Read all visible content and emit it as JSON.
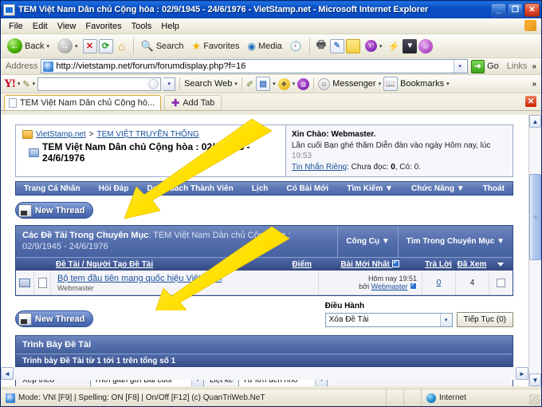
{
  "window": {
    "title": "TEM Việt Nam Dân chủ Cộng hòa : 02/9/1945 - 24/6/1976 - VietStamp.net - Microsoft Internet Explorer",
    "minimize": "_",
    "maximize": "❐",
    "close": "✕"
  },
  "menu": {
    "items": [
      "File",
      "Edit",
      "View",
      "Favorites",
      "Tools",
      "Help"
    ]
  },
  "toolbar": {
    "back_label": "Back",
    "back_caret": "▾",
    "forward_caret": "▾",
    "stop_glyph": "✕",
    "refresh_glyph": "⟳",
    "home_glyph": "⌂",
    "search_label": "Search",
    "search_glyph": "🔍",
    "favorites_label": "Favorites",
    "favorites_glyph": "★",
    "media_label": "Media",
    "media_glyph": "◉",
    "history_glyph": "🕘",
    "print_glyph": "🖶",
    "edit_glyph": "✎",
    "note_glyph": "",
    "yahoo_glyph": "Y!",
    "yahoo_caret": "▾",
    "lightning_glyph": "⚡",
    "dark_glyph": "▼",
    "smiley_glyph": "☺"
  },
  "address": {
    "label": "Address",
    "value": "http://vietstamp.net/forum/forumdisplay.php?f=16",
    "caret": "▾",
    "go_label": "Go",
    "go_glyph": "➜",
    "links_label": "Links",
    "chevron": "»"
  },
  "yahoo_toolbar": {
    "logo": "Y!",
    "logo_caret": "▾",
    "pencil_caret": "▾",
    "search_value": "",
    "search_caret": "▾",
    "search_web_label": "Search Web",
    "search_web_caret": "▾",
    "highlight_glyph": "✐",
    "tabs_glyph": "▤",
    "tabs_caret": "▾",
    "anti_spy_glyph": "✥",
    "anti_spy_caret": "▾",
    "popup_glyph": "◍",
    "messenger_label": "Messenger",
    "messenger_caret": "▾",
    "bookmarks_label": "Bookmarks",
    "bookmarks_caret": "▾",
    "overflow": "»"
  },
  "tabbar": {
    "tabs": [
      {
        "label": "TEM Việt Nam Dân chủ Cộng hò..."
      }
    ],
    "add_tab_label": "Add Tab",
    "add_tab_glyph": "✚",
    "close_glyph": "✕"
  },
  "page": {
    "breadcrumb": {
      "root": "VietStamp.net",
      "separator": ">",
      "parent": "TEM VIỆT TRUYỀN THỐNG",
      "current": "TEM Việt Nam Dân chủ Cộng hòa : 02/9/1945 - 24/6/1976"
    },
    "welcome": {
      "greeting": "Xin Chào: Webmaster.",
      "last_visit": "Lần cuối Bạn ghé thăm Diễn đàn vào ngày Hôm nay, lúc",
      "last_visit_time": "19:53",
      "pm_link": "Tin Nhắn Riêng",
      "pm_text_pre": ": Chưa đọc:",
      "pm_unread": "0",
      "pm_text_mid": ", Có:",
      "pm_total": "0."
    },
    "nav": [
      "Trang Cá Nhân",
      "Hỏi Đáp",
      "Danh Sách Thành Viên",
      "Lịch",
      "Có Bài Mới",
      "Tìm Kiếm ▼",
      "Chức Năng ▼",
      "Thoát"
    ],
    "new_thread_label": "New Thread",
    "forum_panel": {
      "title_bold": "Các Đề Tài Trong Chuyên Mục",
      "title_sub": ": TEM Việt Nam Dân chủ Cộng hòa : 02/9/1945 - 24/6/1976",
      "tool_label": "Công Cụ ▼",
      "search_label": "Tìm Trong Chuyên Mục ▼",
      "headers": {
        "topic": "Đề Tài / Người Tạo Đề Tài",
        "points": "Điểm",
        "last_post": "Bài Mới Nhất",
        "replies": "Trả Lời",
        "views": "Đã Xem",
        "select": "▼"
      },
      "rows": [
        {
          "title": "Bộ tem đầu tiên mang quốc hiệu Việt Nam",
          "author": "Webmaster",
          "last_post_time": "Hôm nay 19:51",
          "last_post_by_prefix": "bởi",
          "last_post_by": "Webmaster",
          "replies": "0",
          "views": "4"
        }
      ]
    },
    "moderation": {
      "label": "Điều Hành",
      "select_value": "Xóa Đề Tài",
      "select_caret": "▾",
      "continue_label": "Tiếp Tục (0)"
    },
    "display_panel": {
      "title": "Trình Bày Đề Tài",
      "subtitle": "Trình bày Đề Tài từ 1 tới 1 trên tổng số 1",
      "sort_label": "Xếp theo",
      "sort_value": "Thời gian gửi Bài cuối",
      "list_label": "Liệt kê",
      "list_value": "Từ lớn đến nhỏ",
      "caret": "▾"
    }
  },
  "scrollbars": {
    "up": "▲",
    "down": "▼",
    "left": "◄",
    "right": "►",
    "grip": "≡"
  },
  "statusbar": {
    "message": "Mode: VNI [F9] | Spelling: ON [F8] | On/Off [F12] (c) QuanTriWeb.NeT",
    "zone": "Internet"
  },
  "colors": {
    "titlebar_blue": "#0a4cc0",
    "panel_header_blue": "#46619f",
    "table_header_blue": "#3f5896",
    "link_blue": "#1a4f9c",
    "annotation_yellow": "#ffe000"
  }
}
